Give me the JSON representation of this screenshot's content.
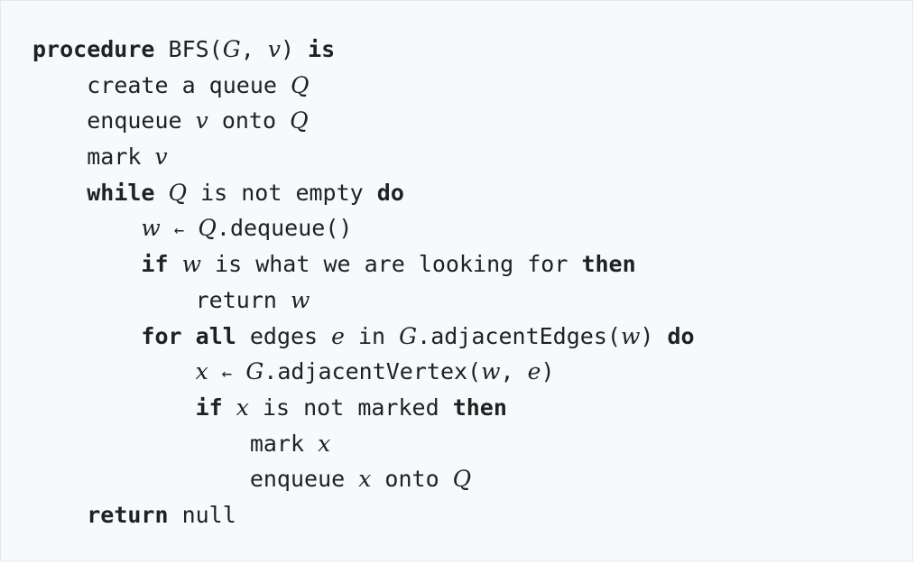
{
  "lines": [
    {
      "indent": 0,
      "tokens": [
        {
          "t": "procedure",
          "k": "kw"
        },
        {
          "t": " BFS(",
          "k": "txt"
        },
        {
          "t": "G",
          "k": "var"
        },
        {
          "t": ", ",
          "k": "txt"
        },
        {
          "t": "v",
          "k": "var"
        },
        {
          "t": ") ",
          "k": "txt"
        },
        {
          "t": "is",
          "k": "kw"
        }
      ]
    },
    {
      "indent": 4,
      "tokens": [
        {
          "t": "create a queue ",
          "k": "txt"
        },
        {
          "t": "Q",
          "k": "var"
        }
      ]
    },
    {
      "indent": 4,
      "tokens": [
        {
          "t": "enqueue ",
          "k": "txt"
        },
        {
          "t": "v",
          "k": "var"
        },
        {
          "t": " onto ",
          "k": "txt"
        },
        {
          "t": "Q",
          "k": "var"
        }
      ]
    },
    {
      "indent": 4,
      "tokens": [
        {
          "t": "mark ",
          "k": "txt"
        },
        {
          "t": "v",
          "k": "var"
        }
      ]
    },
    {
      "indent": 4,
      "tokens": [
        {
          "t": "while",
          "k": "kw"
        },
        {
          "t": " ",
          "k": "txt"
        },
        {
          "t": "Q",
          "k": "var"
        },
        {
          "t": " is not empty ",
          "k": "txt"
        },
        {
          "t": "do",
          "k": "kw"
        }
      ]
    },
    {
      "indent": 8,
      "tokens": [
        {
          "t": "w",
          "k": "var"
        },
        {
          "t": " ",
          "k": "txt"
        },
        {
          "t": "←",
          "k": "op"
        },
        {
          "t": " ",
          "k": "txt"
        },
        {
          "t": "Q",
          "k": "var"
        },
        {
          "t": ".dequeue()",
          "k": "txt"
        }
      ]
    },
    {
      "indent": 8,
      "tokens": [
        {
          "t": "if",
          "k": "kw"
        },
        {
          "t": " ",
          "k": "txt"
        },
        {
          "t": "w",
          "k": "var"
        },
        {
          "t": " is what we are looking for ",
          "k": "txt"
        },
        {
          "t": "then",
          "k": "kw"
        }
      ]
    },
    {
      "indent": 12,
      "tokens": [
        {
          "t": "return ",
          "k": "txt"
        },
        {
          "t": "w",
          "k": "var"
        }
      ]
    },
    {
      "indent": 8,
      "tokens": [
        {
          "t": "for",
          "k": "kw"
        },
        {
          "t": " ",
          "k": "txt"
        },
        {
          "t": "all",
          "k": "kw"
        },
        {
          "t": " edges ",
          "k": "txt"
        },
        {
          "t": "e",
          "k": "var"
        },
        {
          "t": " in ",
          "k": "txt"
        },
        {
          "t": "G",
          "k": "var"
        },
        {
          "t": ".adjacentEdges(",
          "k": "txt"
        },
        {
          "t": "w",
          "k": "var"
        },
        {
          "t": ") ",
          "k": "txt"
        },
        {
          "t": "do",
          "k": "kw"
        }
      ]
    },
    {
      "indent": 12,
      "tokens": [
        {
          "t": "x",
          "k": "var"
        },
        {
          "t": " ",
          "k": "txt"
        },
        {
          "t": "←",
          "k": "op"
        },
        {
          "t": " ",
          "k": "txt"
        },
        {
          "t": "G",
          "k": "var"
        },
        {
          "t": ".adjacentVertex(",
          "k": "txt"
        },
        {
          "t": "w",
          "k": "var"
        },
        {
          "t": ", ",
          "k": "txt"
        },
        {
          "t": "e",
          "k": "var"
        },
        {
          "t": ")",
          "k": "txt"
        }
      ]
    },
    {
      "indent": 12,
      "tokens": [
        {
          "t": "if",
          "k": "kw"
        },
        {
          "t": " ",
          "k": "txt"
        },
        {
          "t": "x",
          "k": "var"
        },
        {
          "t": " is not marked ",
          "k": "txt"
        },
        {
          "t": "then",
          "k": "kw"
        }
      ]
    },
    {
      "indent": 16,
      "tokens": [
        {
          "t": "mark ",
          "k": "txt"
        },
        {
          "t": "x",
          "k": "var"
        }
      ]
    },
    {
      "indent": 16,
      "tokens": [
        {
          "t": "enqueue ",
          "k": "txt"
        },
        {
          "t": "x",
          "k": "var"
        },
        {
          "t": " onto ",
          "k": "txt"
        },
        {
          "t": "Q",
          "k": "var"
        }
      ]
    },
    {
      "indent": 4,
      "tokens": [
        {
          "t": "return",
          "k": "kw"
        },
        {
          "t": " null",
          "k": "txt"
        }
      ]
    }
  ]
}
